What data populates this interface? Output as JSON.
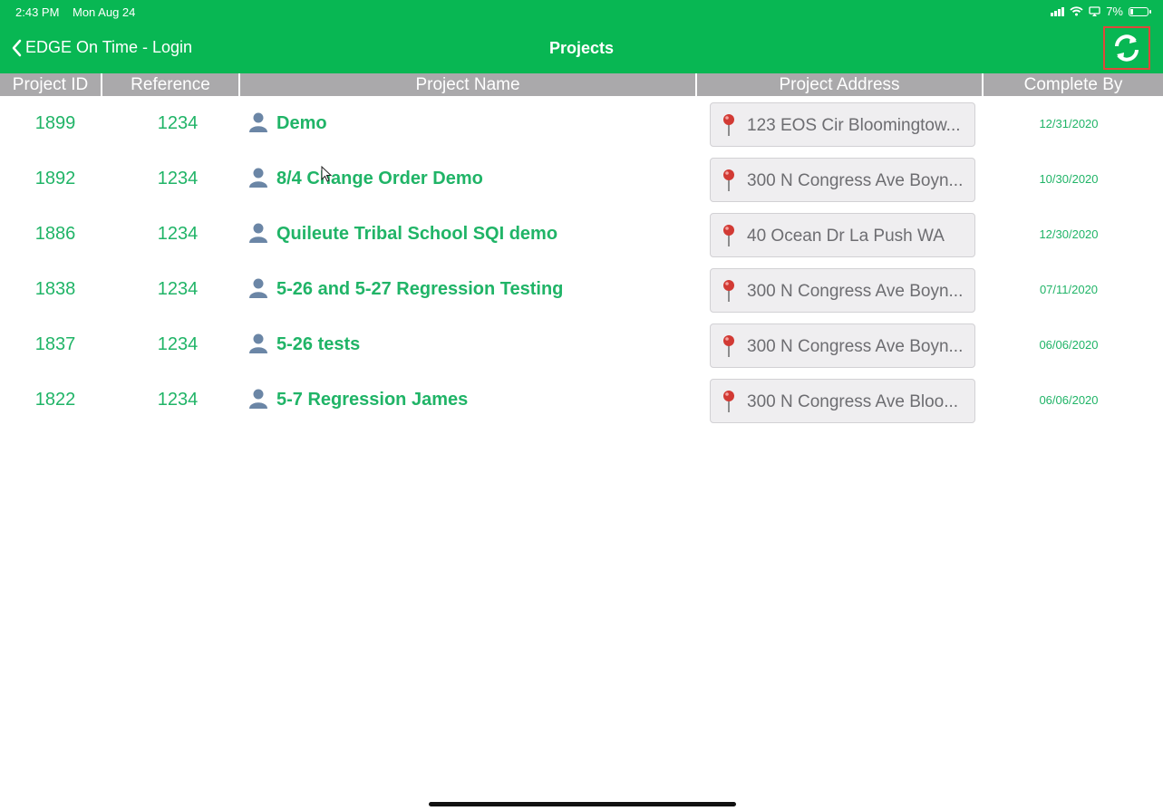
{
  "status_bar": {
    "time": "2:43 PM",
    "date": "Mon Aug 24",
    "battery": "7%"
  },
  "nav": {
    "back_label": "EDGE On Time - Login",
    "title": "Projects",
    "refresh_icon": "refresh-icon"
  },
  "colors": {
    "accent": "#08b753",
    "text_green": "#20b467",
    "header_gray": "#aaa9ab",
    "highlight": "#e0473a"
  },
  "columns": [
    "Project ID",
    "Reference",
    "Project Name",
    "Project Address",
    "Complete By"
  ],
  "rows": [
    {
      "id": "1899",
      "ref": "1234",
      "name": "Demo",
      "address": "123 EOS Cir  Bloomingtow...",
      "due": "12/31/2020"
    },
    {
      "id": "1892",
      "ref": "1234",
      "name": "8/4 Change Order Demo",
      "address": "300 N Congress Ave  Boyn...",
      "due": "10/30/2020"
    },
    {
      "id": "1886",
      "ref": "1234",
      "name": "Quileute Tribal School SQI demo",
      "address": "40 Ocean Dr  La Push WA",
      "due": "12/30/2020"
    },
    {
      "id": "1838",
      "ref": "1234",
      "name": "5-26 and 5-27 Regression Testing",
      "address": "300 N Congress Ave  Boyn...",
      "due": "07/11/2020"
    },
    {
      "id": "1837",
      "ref": "1234",
      "name": "5-26 tests",
      "address": "300 N Congress Ave  Boyn...",
      "due": "06/06/2020"
    },
    {
      "id": "1822",
      "ref": "1234",
      "name": "5-7 Regression James",
      "address": "300 N Congress Ave  Bloo...",
      "due": "06/06/2020"
    }
  ]
}
